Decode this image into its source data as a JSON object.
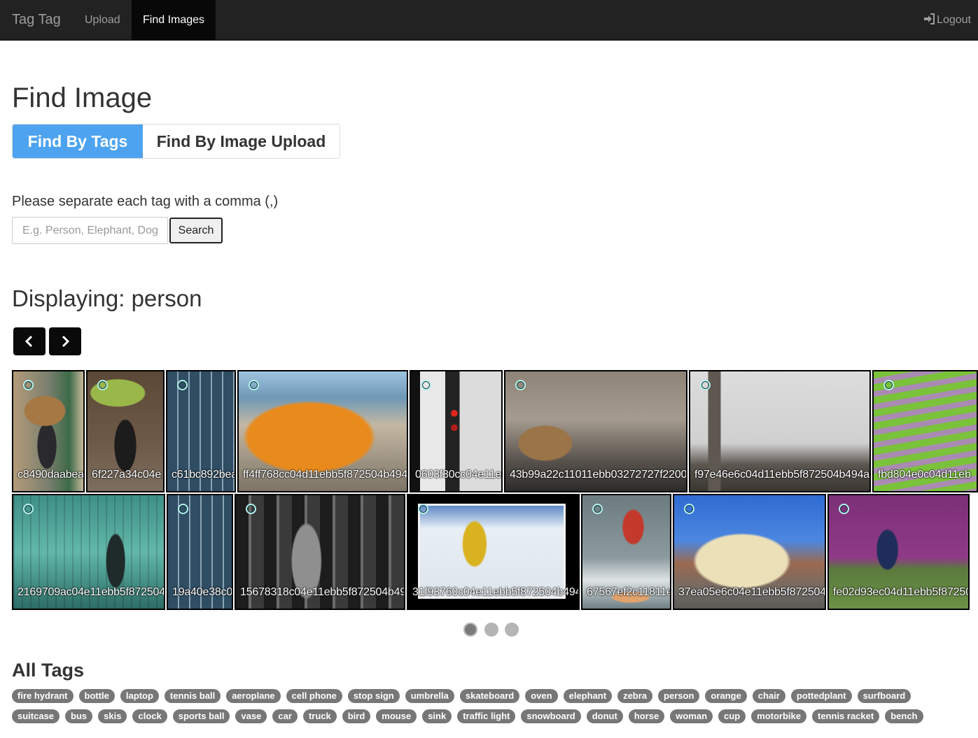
{
  "navbar": {
    "brand": "Tag Tag",
    "upload": "Upload",
    "find_images": "Find Images",
    "logout": "Logout"
  },
  "page": {
    "title": "Find Image",
    "tabs": {
      "by_tags": "Find By Tags",
      "by_upload": "Find By Image Upload"
    },
    "hint": "Please separate each tag with a comma (,)",
    "search_placeholder": "E.g. Person, Elephant, Dog.",
    "search_button": "Search",
    "displaying": "Displaying: person"
  },
  "gallery": {
    "row1": [
      {
        "caption": "c8490daabea",
        "scene": "man with umbrella"
      },
      {
        "caption": "6f227a34c04e",
        "scene": "woman with green umbrella"
      },
      {
        "caption": "c61bc892bea",
        "scene": "glass building"
      },
      {
        "caption": "ff4ff768cc04d11ebb5f872504b494a",
        "scene": "orange van with bananas"
      },
      {
        "caption": "0603f30cc04e11e",
        "scene": "traffic light street"
      },
      {
        "caption": "43b99a22c11011ebb03272727f2200",
        "scene": "cable car street"
      },
      {
        "caption": "f97e46e6c04d11ebb5f872504b494a",
        "scene": "big ben"
      },
      {
        "caption": "fbd804e0c04d11eb",
        "scene": "green benches park"
      }
    ],
    "row2": [
      {
        "caption": "2169709ac04e11ebb5f872504",
        "scene": "girl in green window"
      },
      {
        "caption": "19a40e38c0",
        "scene": "glass building"
      },
      {
        "caption": "15678318c04e11ebb5f872504b49",
        "scene": "woman on phone"
      },
      {
        "caption": "31f93760c04e11ebb5f872504b494",
        "scene": "snowboarder"
      },
      {
        "caption": "67567ef2c11811e",
        "scene": "surfer"
      },
      {
        "caption": "37ea05e6c04e11ebb5f872504",
        "scene": "double decker bus"
      },
      {
        "caption": "fe02d93ec04d11ebb5f87250",
        "scene": "tennis player"
      }
    ]
  },
  "carousel": {
    "pages": 3,
    "active": 0
  },
  "all_tags": {
    "title": "All Tags",
    "row1": [
      "fire hydrant",
      "bottle",
      "laptop",
      "tennis ball",
      "aeroplane",
      "cell phone",
      "stop sign",
      "umbrella",
      "skateboard",
      "oven",
      "elephant",
      "zebra",
      "person",
      "orange",
      "chair",
      "pottedplant",
      "surfboard"
    ],
    "row2": [
      "suitcase",
      "bus",
      "skis",
      "clock",
      "sports ball",
      "vase",
      "car",
      "truck",
      "bird",
      "mouse",
      "sink",
      "traffic light",
      "snowboard",
      "donut",
      "horse",
      "woman",
      "cup",
      "motorbike",
      "tennis racket",
      "bench"
    ]
  }
}
